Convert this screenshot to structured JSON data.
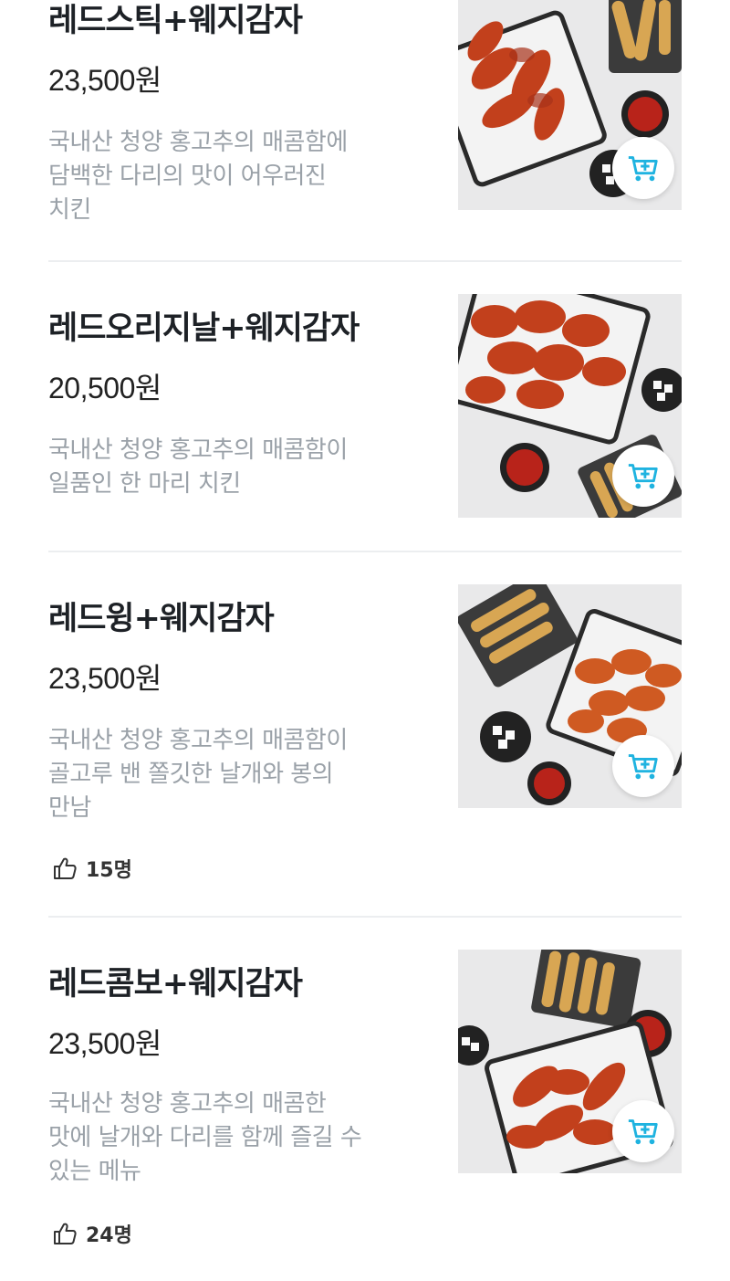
{
  "menu": {
    "items": [
      {
        "title": "레드스틱+웨지감자",
        "price": "23,500원",
        "description_lines": [
          "국내산 청양 홍고추의 매콤함에",
          "담백한 다리의 맛이 어우러진",
          "치킨"
        ],
        "likes": ""
      },
      {
        "title": "레드오리지날+웨지감자",
        "price": "20,500원",
        "description_lines": [
          "국내산 청양 홍고추의 매콤함이",
          "일품인 한 마리 치킨"
        ],
        "likes": ""
      },
      {
        "title": "레드윙+웨지감자",
        "price": "23,500원",
        "description_lines": [
          "국내산 청양 홍고추의 매콤함이",
          "골고루 밴 쫄깃한 날개와 봉의",
          "만남"
        ],
        "likes": "15명"
      },
      {
        "title": "레드콤보+웨지감자",
        "price": "23,500원",
        "description_lines": [
          "국내산 청양 홍고추의 매콤한",
          "맛에 날개와 다리를 함께 즐길 수",
          "있는 메뉴"
        ],
        "likes": "24명"
      }
    ]
  },
  "icons": {
    "like": "thumbs-up-icon",
    "cart": "add-to-cart-icon"
  },
  "colors": {
    "accent": "#1fb3e0",
    "description": "#9aa1a8",
    "divider": "#eceef0",
    "chicken": "#c2401c"
  }
}
